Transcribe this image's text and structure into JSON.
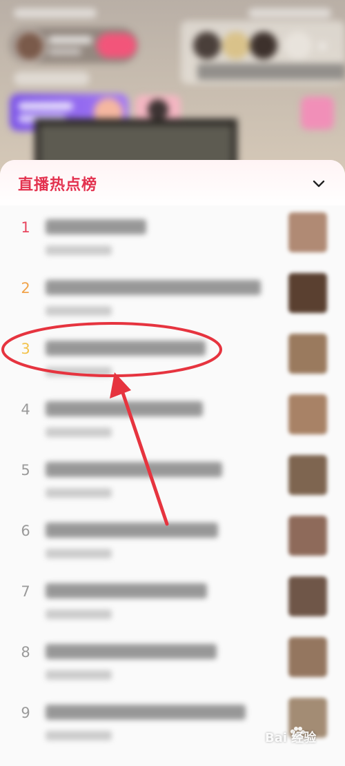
{
  "sheet": {
    "title": "直播热点榜"
  },
  "list": {
    "items": [
      {
        "rank": "1"
      },
      {
        "rank": "2"
      },
      {
        "rank": "3"
      },
      {
        "rank": "4"
      },
      {
        "rank": "5"
      },
      {
        "rank": "6"
      },
      {
        "rank": "7"
      },
      {
        "rank": "8"
      },
      {
        "rank": "9"
      }
    ]
  },
  "colors": {
    "title": "#e3324f",
    "rank_1": "#e8455e",
    "rank_2": "#f1a34a",
    "rank_3": "#f3c24a",
    "rank_other": "#9a9a9a",
    "annotation": "#e6343f"
  },
  "icons": {
    "collapse": "chevron-down-icon",
    "watermark": "baidu-paw-icon"
  },
  "watermark": {
    "text": "Bai 经验"
  }
}
